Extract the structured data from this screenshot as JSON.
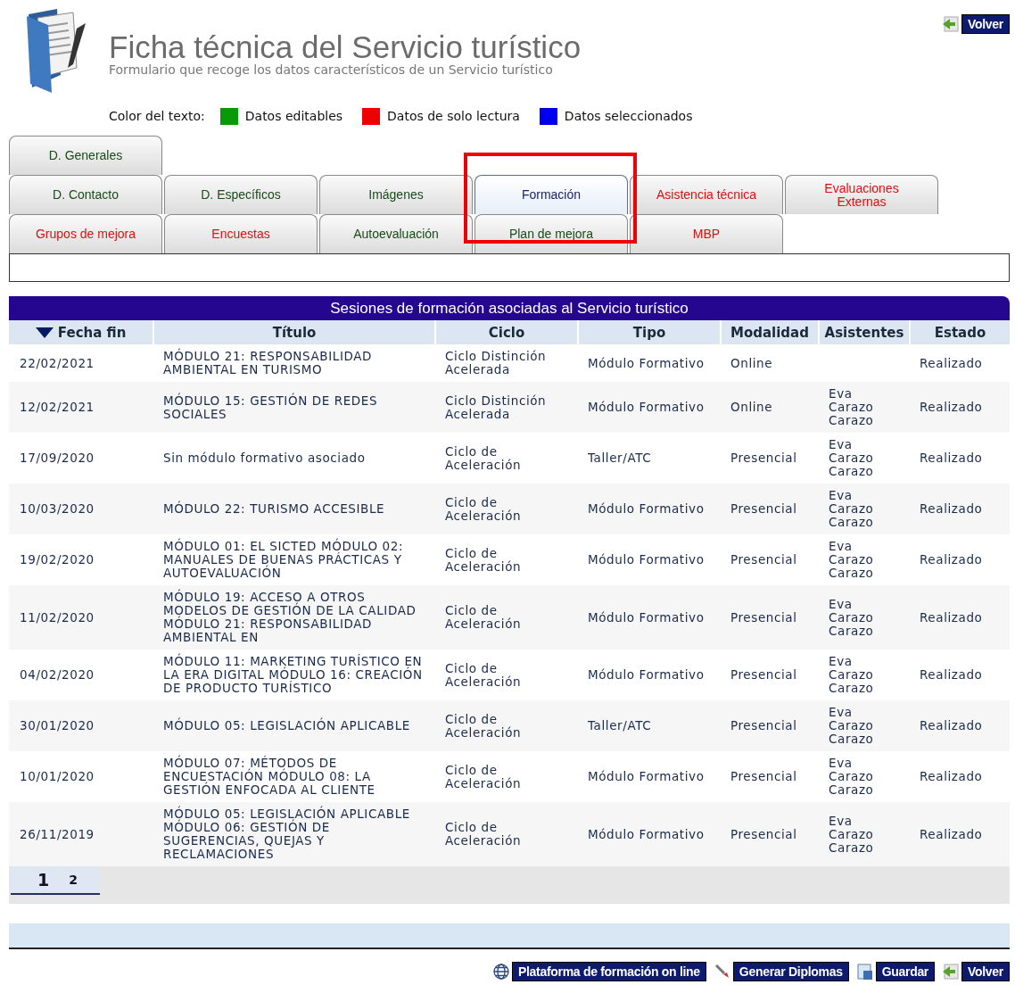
{
  "header": {
    "title": "Ficha técnica del Servicio turístico",
    "subtitle": "Formulario que recoge los datos característicos de un Servicio turístico",
    "back_button": "Volver"
  },
  "legend": {
    "label": "Color del texto:",
    "items": [
      {
        "label": "Datos editables",
        "color": "#089a08"
      },
      {
        "label": "Datos de solo lectura",
        "color": "#ee0000"
      },
      {
        "label": "Datos seleccionados",
        "color": "#0000ee"
      }
    ]
  },
  "tab_rows": [
    [
      {
        "label": "D. Generales",
        "color": "#1a4a1a",
        "selected": false,
        "highlighted": false
      }
    ],
    [
      {
        "label": "D. Contacto",
        "color": "#1a4a1a",
        "selected": false,
        "highlighted": false
      },
      {
        "label": "D. Específicos",
        "color": "#1a4a1a",
        "selected": false,
        "highlighted": false
      },
      {
        "label": "Imágenes",
        "color": "#1a4a1a",
        "selected": false,
        "highlighted": false
      },
      {
        "label": "Formación",
        "color": "#22226a",
        "selected": true,
        "highlighted": true
      },
      {
        "label": "Asistencia técnica",
        "color": "#dd1111",
        "selected": false,
        "highlighted": false
      },
      {
        "label": "Evaluaciones Externas",
        "color": "#dd1111",
        "selected": false,
        "highlighted": false
      }
    ],
    [
      {
        "label": "Grupos de mejora",
        "color": "#dd1111",
        "selected": false,
        "highlighted": false
      },
      {
        "label": "Encuestas",
        "color": "#dd1111",
        "selected": false,
        "highlighted": false
      },
      {
        "label": "Autoevaluación",
        "color": "#1a4a1a",
        "selected": false,
        "highlighted": false
      },
      {
        "label": "Plan de mejora",
        "color": "#1a4a1a",
        "selected": false,
        "highlighted": false
      },
      {
        "label": "MBP",
        "color": "#dd1111",
        "selected": false,
        "highlighted": false
      }
    ]
  ],
  "table": {
    "title": "Sesiones de formación asociadas al Servicio turístico",
    "columns": [
      {
        "label": "Fecha fin",
        "sorted": true
      },
      {
        "label": "Título",
        "sorted": false
      },
      {
        "label": "Ciclo",
        "sorted": false
      },
      {
        "label": "Tipo",
        "sorted": false
      },
      {
        "label": "Modalidad",
        "sorted": false
      },
      {
        "label": "Asistentes",
        "sorted": false
      },
      {
        "label": "Estado",
        "sorted": false
      }
    ],
    "rows": [
      [
        "22/02/2021",
        "MÓDULO 21: RESPONSABILIDAD AMBIENTAL EN TURISMO",
        "Ciclo Distinción Acelerada",
        "Módulo Formativo",
        "Online",
        "",
        "Realizado"
      ],
      [
        "12/02/2021",
        "MÓDULO 15: GESTIÓN DE REDES SOCIALES",
        "Ciclo Distinción Acelerada",
        "Módulo Formativo",
        "Online",
        "Eva Carazo Carazo",
        "Realizado"
      ],
      [
        "17/09/2020",
        "Sin módulo formativo asociado",
        "Ciclo de Aceleración",
        "Taller/ATC",
        "Presencial",
        "Eva Carazo Carazo",
        "Realizado"
      ],
      [
        "10/03/2020",
        "MÓDULO 22: TURISMO ACCESIBLE",
        "Ciclo de Aceleración",
        "Módulo Formativo",
        "Presencial",
        "Eva Carazo Carazo",
        "Realizado"
      ],
      [
        "19/02/2020",
        "MÓDULO 01: EL SICTED MÓDULO 02: MANUALES DE BUENAS PRÁCTICAS Y AUTOEVALUACIÓN",
        "Ciclo de Aceleración",
        "Módulo Formativo",
        "Presencial",
        "Eva Carazo Carazo",
        "Realizado"
      ],
      [
        "11/02/2020",
        "MÓDULO 19: ACCESO A OTROS MODELOS DE GESTIÓN DE LA CALIDAD MÓDULO 21: RESPONSABILIDAD AMBIENTAL EN",
        "Ciclo de Aceleración",
        "Módulo Formativo",
        "Presencial",
        "Eva Carazo Carazo",
        "Realizado"
      ],
      [
        "04/02/2020",
        "MÓDULO 11: MARKETING TURÍSTICO EN LA ERA DIGITAL MÓDULO 16: CREACIÓN DE PRODUCTO TURÍSTICO",
        "Ciclo de Aceleración",
        "Módulo Formativo",
        "Presencial",
        "Eva Carazo Carazo",
        "Realizado"
      ],
      [
        "30/01/2020",
        "MÓDULO 05: LEGISLACIÓN APLICABLE",
        "Ciclo de Aceleración",
        "Taller/ATC",
        "Presencial",
        "Eva Carazo Carazo",
        "Realizado"
      ],
      [
        "10/01/2020",
        "MÓDULO 07: MÉTODOS DE ENCUESTACIÓN MÓDULO 08: LA GESTIÓN ENFOCADA AL CLIENTE",
        "Ciclo de Aceleración",
        "Módulo Formativo",
        "Presencial",
        "Eva Carazo Carazo",
        "Realizado"
      ],
      [
        "26/11/2019",
        "MÓDULO 05: LEGISLACIÓN APLICABLE MÓDULO 06: GESTIÓN DE SUGERENCIAS, QUEJAS Y RECLAMACIONES",
        "Ciclo de Aceleración",
        "Módulo Formativo",
        "Presencial",
        "Eva Carazo Carazo",
        "Realizado"
      ]
    ],
    "pages": [
      {
        "label": "1",
        "selected": true
      },
      {
        "label": "2",
        "selected": false
      }
    ]
  },
  "footer_buttons": [
    {
      "label": "Plataforma de formación on line",
      "kind": "globe"
    },
    {
      "label": "Generar Diplomas",
      "kind": "tool"
    },
    {
      "label": "Guardar",
      "kind": "save"
    },
    {
      "label": "Volver",
      "kind": "back"
    }
  ]
}
